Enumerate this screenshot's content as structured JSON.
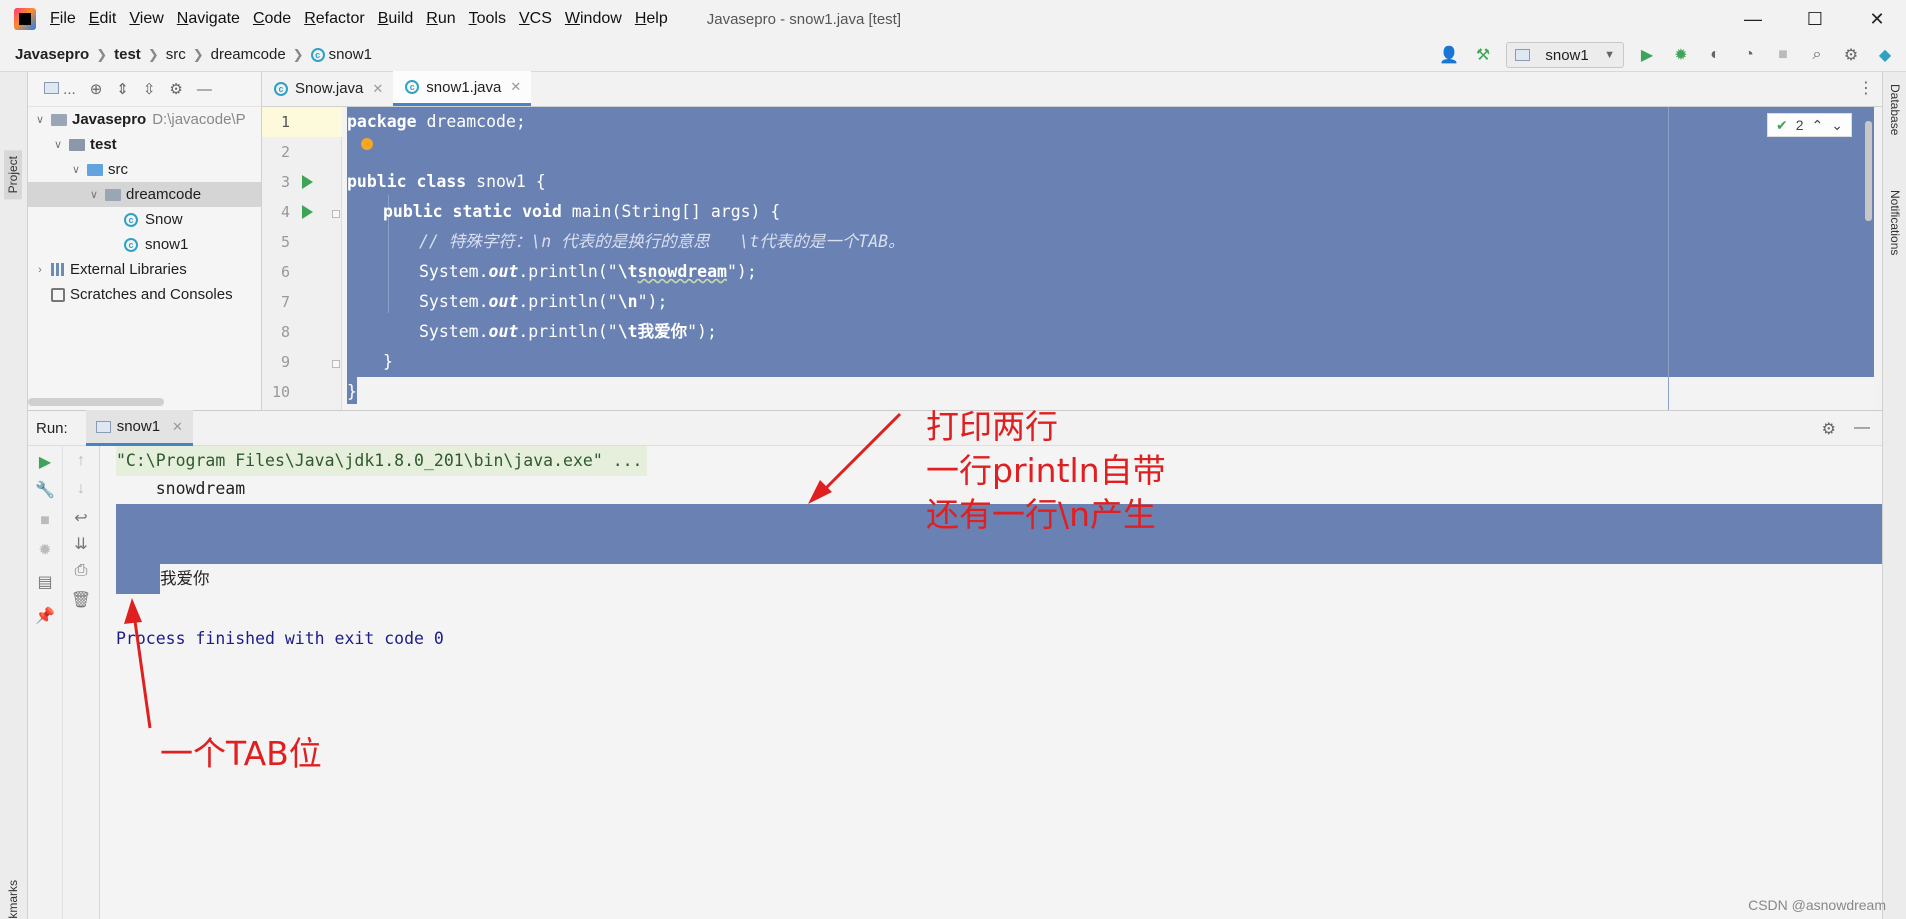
{
  "menu": {
    "items": [
      "File",
      "Edit",
      "View",
      "Navigate",
      "Code",
      "Refactor",
      "Build",
      "Run",
      "Tools",
      "VCS",
      "Window",
      "Help"
    ],
    "window_title": "Javasepro - snow1.java [test]"
  },
  "window_controls": {
    "minimize": "—",
    "maximize": "☐",
    "close": "✕"
  },
  "breadcrumb": [
    "Javasepro",
    "test",
    "src",
    "dreamcode",
    "snow1"
  ],
  "toolbar": {
    "run_config": "snow1"
  },
  "left_stripe": {
    "project": "Project",
    "bookmarks": "Bookmarks"
  },
  "right_stripe": {
    "database": "Database",
    "notifications": "Notifications"
  },
  "project_panel": {
    "toolbar_label": "...",
    "tree": [
      {
        "label": "Javasepro",
        "hint": "D:\\javacode\\P",
        "level": 0
      },
      {
        "label": "test",
        "level": 1
      },
      {
        "label": "src",
        "level": 2
      },
      {
        "label": "dreamcode",
        "level": 3
      },
      {
        "label": "Snow",
        "level": 4
      },
      {
        "label": "snow1",
        "level": 4
      },
      {
        "label": "External Libraries",
        "level": 0
      },
      {
        "label": "Scratches and Consoles",
        "level": 0
      }
    ]
  },
  "editor": {
    "tabs": [
      {
        "label": "Snow.java",
        "active": false
      },
      {
        "label": "snow1.java",
        "active": true
      }
    ],
    "line_numbers": [
      "1",
      "2",
      "3",
      "4",
      "5",
      "6",
      "7",
      "8",
      "9",
      "10"
    ],
    "lines": {
      "l1_kw": "package",
      "l1_rest": " dreamcode;",
      "l3_kw": "public class",
      "l3_rest": " snow1 {",
      "l4_kw": "public static void",
      "l4_rest": " main(String[] args) {",
      "l5_comment": "// 特殊字符：\\n 代表的是换行的意思   \\t代表的是一个TAB。",
      "l6_pre": "System.",
      "l6_out": "out",
      "l6_mid": ".println(\"",
      "l6_esc": "\\t",
      "l6_word": "snowdream",
      "l6_post": "\");",
      "l7_pre": "System.",
      "l7_out": "out",
      "l7_mid": ".println(\"",
      "l7_esc": "\\n",
      "l7_post": "\");",
      "l8_pre": "System.",
      "l8_out": "out",
      "l8_mid": ".println(\"",
      "l8_esc": "\\t我爱你",
      "l8_post": "\");",
      "l9": "}",
      "l10": "}"
    },
    "inspection_count": "2"
  },
  "run_panel": {
    "label": "Run:",
    "tab": "snow1",
    "console": {
      "command": "\"C:\\Program Files\\Java\\jdk1.8.0_201\\bin\\java.exe\" ...",
      "line1": "    snowdream",
      "line3": "我爱你",
      "exit": "Process finished with exit code 0"
    }
  },
  "annotations": {
    "top_lines": [
      "打印两行",
      "一行println自带",
      "还有一行\\n产生"
    ],
    "bottom": "一个TAB位",
    "color": "#e02020"
  },
  "watermark": "CSDN @asnowdream",
  "colors": {
    "selection": "#6a82b3",
    "accent": "#4a83c5",
    "run_green": "#3ea558"
  }
}
